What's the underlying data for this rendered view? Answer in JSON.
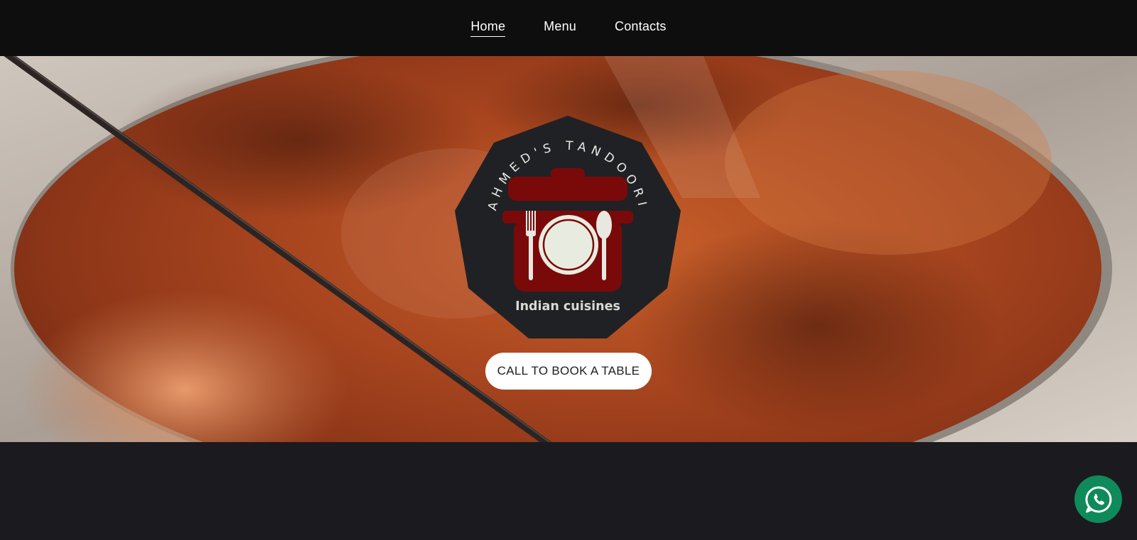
{
  "nav": {
    "items": [
      {
        "label": "Home",
        "active": true
      },
      {
        "label": "Menu",
        "active": false
      },
      {
        "label": "Contacts",
        "active": false
      }
    ]
  },
  "hero": {
    "background": "tandoor-oven-photo",
    "logo": {
      "brand_name": "AHMED'S TANDOORI",
      "tagline": "Indian cuisines",
      "icon": "cooking-pot-with-plate-fork-spoon-icon",
      "badge_color": "#202124",
      "pot_color": "#7a0a0a"
    },
    "cta_label": "CALL TO BOOK A TABLE"
  },
  "floating": {
    "whatsapp_icon": "whatsapp-icon",
    "color": "#0f8a5a"
  }
}
